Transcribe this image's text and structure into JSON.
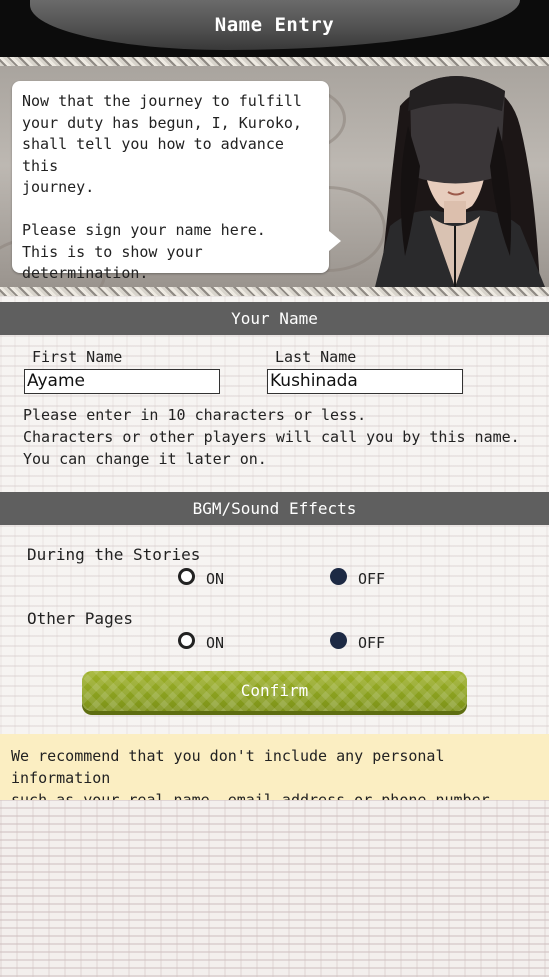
{
  "header": {
    "title": "Name Entry"
  },
  "dialogue": {
    "text": "Now that the journey to fulfill\nyour duty has begun, I, Kuroko,\nshall tell you how to advance this\njourney.\n\nPlease sign your name here.\nThis is to show your\ndetermination."
  },
  "name_section": {
    "title": "Your Name",
    "first_name_label": "First Name",
    "first_name_value": "Ayame",
    "last_name_label": "Last Name",
    "last_name_value": "Kushinada",
    "note": "Please enter in 10 characters or less.\nCharacters or other players will call you by this name.\nYou can change it later on."
  },
  "sound_section": {
    "title": "BGM/Sound Effects",
    "rows": [
      {
        "label": "During the Stories",
        "on_label": "ON",
        "off_label": "OFF",
        "selected": "OFF"
      },
      {
        "label": "Other Pages",
        "on_label": "ON",
        "off_label": "OFF",
        "selected": "OFF"
      }
    ]
  },
  "confirm_label": "Confirm",
  "warning": "We recommend that you don't include any personal information\nsuch as your real name, email address or phone number.",
  "colors": {
    "header_bg": "#0c0c0c",
    "section_bar": "#5f5f5f",
    "confirm_green": "#8aa01f",
    "warning_bg": "#fbeec2",
    "radio_selected": "#1d2a44"
  }
}
